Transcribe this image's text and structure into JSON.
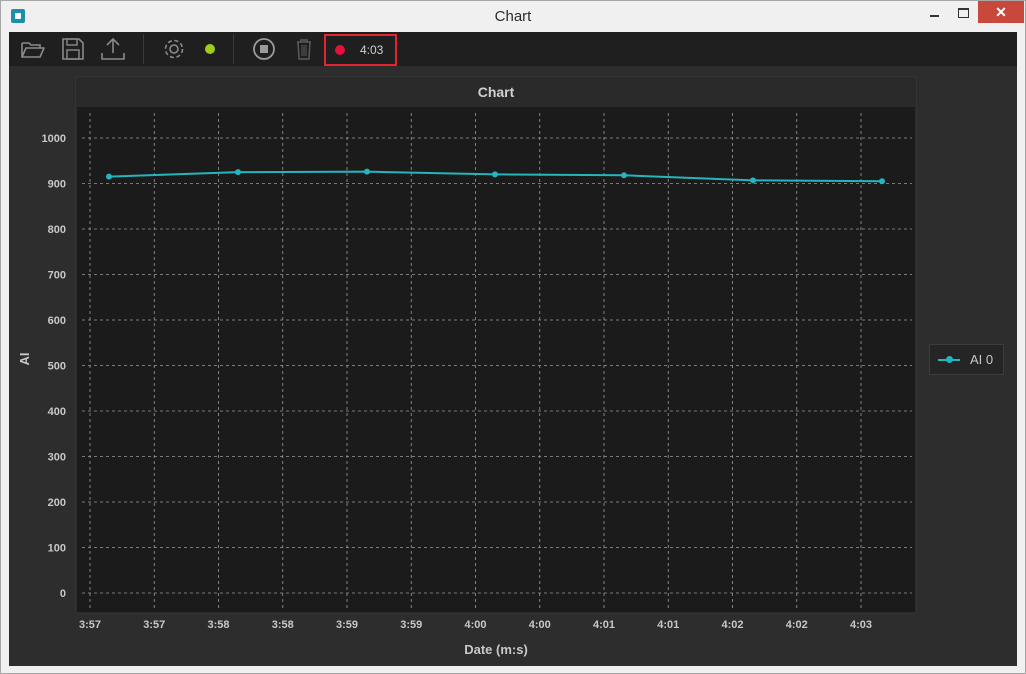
{
  "window": {
    "title": "Chart"
  },
  "toolbar": {
    "status_color": "#9dce1b",
    "recording_color": "#e2113d",
    "elapsed": "4:03",
    "icons": [
      "folder-open-icon",
      "save-icon",
      "upload-icon",
      "settings-gear-icon",
      "stop-icon",
      "trash-icon"
    ]
  },
  "chart_data": {
    "type": "line",
    "title": "Chart",
    "xlabel": "Date (m:s)",
    "ylabel": "AI",
    "ylim": [
      0,
      1000
    ],
    "yticks": [
      0,
      100,
      200,
      300,
      400,
      500,
      600,
      700,
      800,
      900,
      1000
    ],
    "xticks": [
      "3:57",
      "3:57",
      "3:58",
      "3:58",
      "3:59",
      "3:59",
      "4:00",
      "4:00",
      "4:01",
      "4:01",
      "4:02",
      "4:02",
      "4:03"
    ],
    "grid": true,
    "legend_position": "right",
    "series": [
      {
        "name": "AI 0",
        "color": "#26b4be",
        "x": [
          "3:57",
          "3:58",
          "3:59",
          "4:00",
          "4:01",
          "4:02",
          "4:03"
        ],
        "values": [
          915,
          925,
          926,
          920,
          918,
          907,
          905
        ]
      }
    ]
  }
}
